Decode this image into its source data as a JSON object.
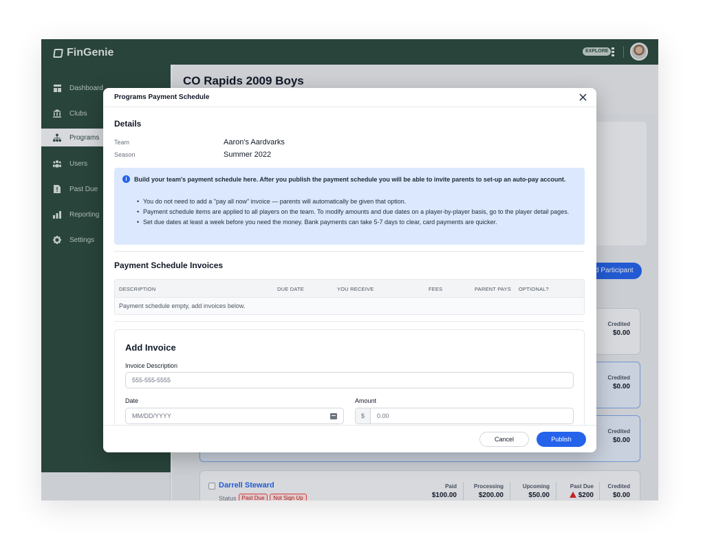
{
  "app": {
    "name": "FinGenie",
    "explore_label": "EXPLORE"
  },
  "sidebar": {
    "items": [
      {
        "label": "Dashboard",
        "icon": "dashboard-icon"
      },
      {
        "label": "Clubs",
        "icon": "bank-icon"
      },
      {
        "label": "Programs",
        "icon": "hierarchy-icon",
        "active": true
      },
      {
        "label": "Users",
        "icon": "users-icon"
      },
      {
        "label": "Past Due",
        "icon": "alert-file-icon"
      },
      {
        "label": "Reporting",
        "icon": "bar-chart-icon"
      },
      {
        "label": "Settings",
        "icon": "gear-icon"
      }
    ]
  },
  "page": {
    "title": "CO Rapids 2009 Boys",
    "add_participant_label": "d Participant",
    "credited_label": "Credited",
    "credited_value": "$0.00",
    "player": {
      "name": "Darrell Steward",
      "status_label": "Status",
      "badges": [
        "Past Due",
        "Not Sign Up"
      ],
      "stats": [
        {
          "label": "Paid",
          "value": "$100.00"
        },
        {
          "label": "Processing",
          "value": "$200.00"
        },
        {
          "label": "Upcoming",
          "value": "$50.00"
        },
        {
          "label": "Past Due",
          "value": "$200"
        },
        {
          "label": "Credited",
          "value": "$0.00"
        }
      ]
    }
  },
  "modal": {
    "title": "Programs Payment Schedule",
    "details_heading": "Details",
    "team_label": "Team",
    "team_value": "Aaron's Aardvarks",
    "season_label": "Season",
    "season_value": "Summer 2022",
    "info": {
      "headline": "Build your team's payment schedule here. After you publish the payment schedule you will be able to invite parents to set-up an auto-pay account.",
      "bullets": [
        "You do not need to add a \"pay all now\" invoice — parents will automatically be given that option.",
        "Payment schedule items are applied to all players on the team. To modify amounts and due dates on a player-by-player basis, go to the player detail pages.",
        "Set due dates at least a week before you need the money. Bank payments can take 5-7 days to clear, card payments are quicker."
      ]
    },
    "invoices_heading": "Payment Schedule Invoices",
    "table_columns": [
      "DESCRIPTION",
      "DUE DATE",
      "YOU RECEIVE",
      "FEES",
      "PARENT PAYS",
      "OPTIONAL?"
    ],
    "table_empty": "Payment schedule empty, add invoices below.",
    "add_invoice": {
      "heading": "Add Invoice",
      "description_label": "Invoice Description",
      "description_placeholder": "555-555-5555",
      "date_label": "Date",
      "date_placeholder": "MM/DD/YYYY",
      "amount_label": "Amount",
      "amount_prefix": "$",
      "amount_placeholder": "0.00"
    },
    "cancel_label": "Cancel",
    "publish_label": "Publish"
  }
}
